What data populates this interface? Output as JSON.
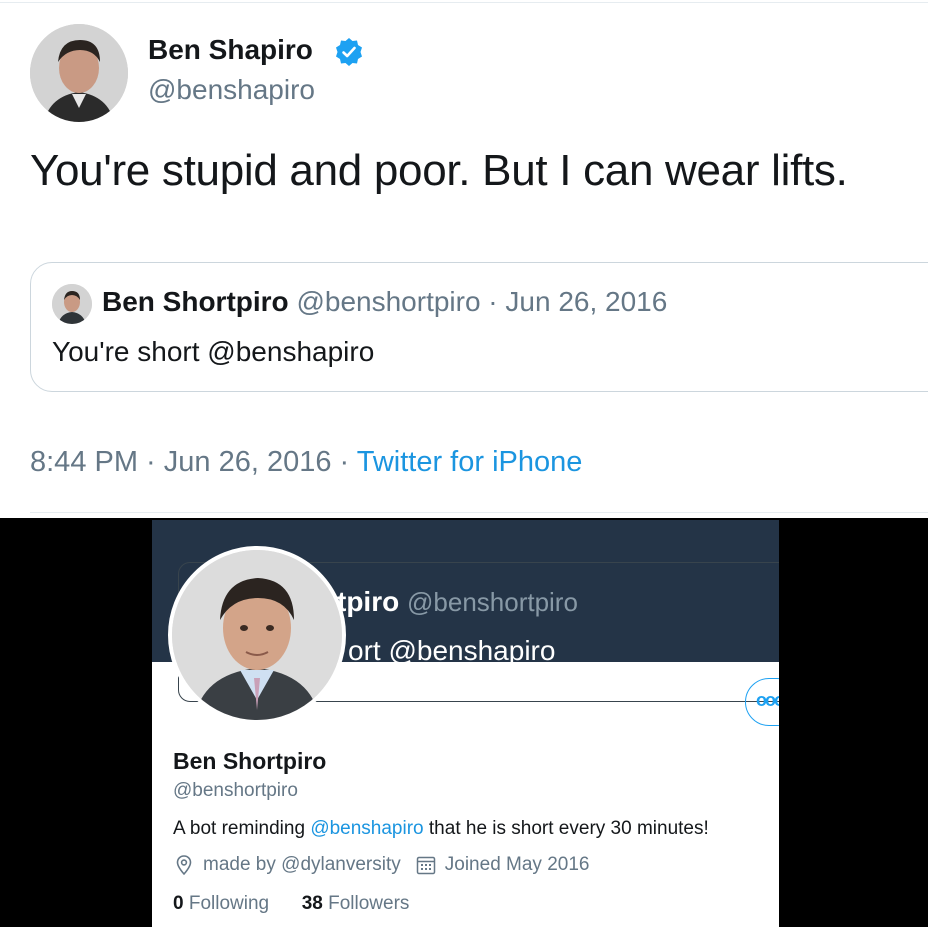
{
  "tweet": {
    "author_name": "Ben Shapiro",
    "author_handle": "@benshapiro",
    "text": "You're stupid and poor. But I can wear lifts.",
    "quote": {
      "author_name": "Ben Shortpiro",
      "meta": "@benshortpiro · Jun 26, 2016",
      "text": "You're short @benshapiro"
    },
    "time": "8:44 PM · Jun 26, 2016 · ",
    "source": "Twitter for iPhone"
  },
  "profile": {
    "header_name_partial": "tpiro",
    "header_handle": "@benshortpiro",
    "header_text_partial": "ort @benshapiro",
    "more_label": "ooo",
    "name": "Ben Shortpiro",
    "handle": "@benshortpiro",
    "bio_before": "A bot reminding ",
    "bio_link": "@benshapiro",
    "bio_after": " that he is short every 30 minutes!",
    "location": "made by @dylanversity",
    "joined": "Joined May 2016",
    "following_count": "0",
    "following_label": " Following",
    "followers_count": "38",
    "followers_label": " Followers"
  },
  "colors": {
    "link": "#1b95e0",
    "verified": "#1da1f2",
    "dark_header": "#243447"
  },
  "icons": [
    "verified-badge-icon",
    "location-pin-icon",
    "calendar-icon",
    "more-options-icon"
  ]
}
